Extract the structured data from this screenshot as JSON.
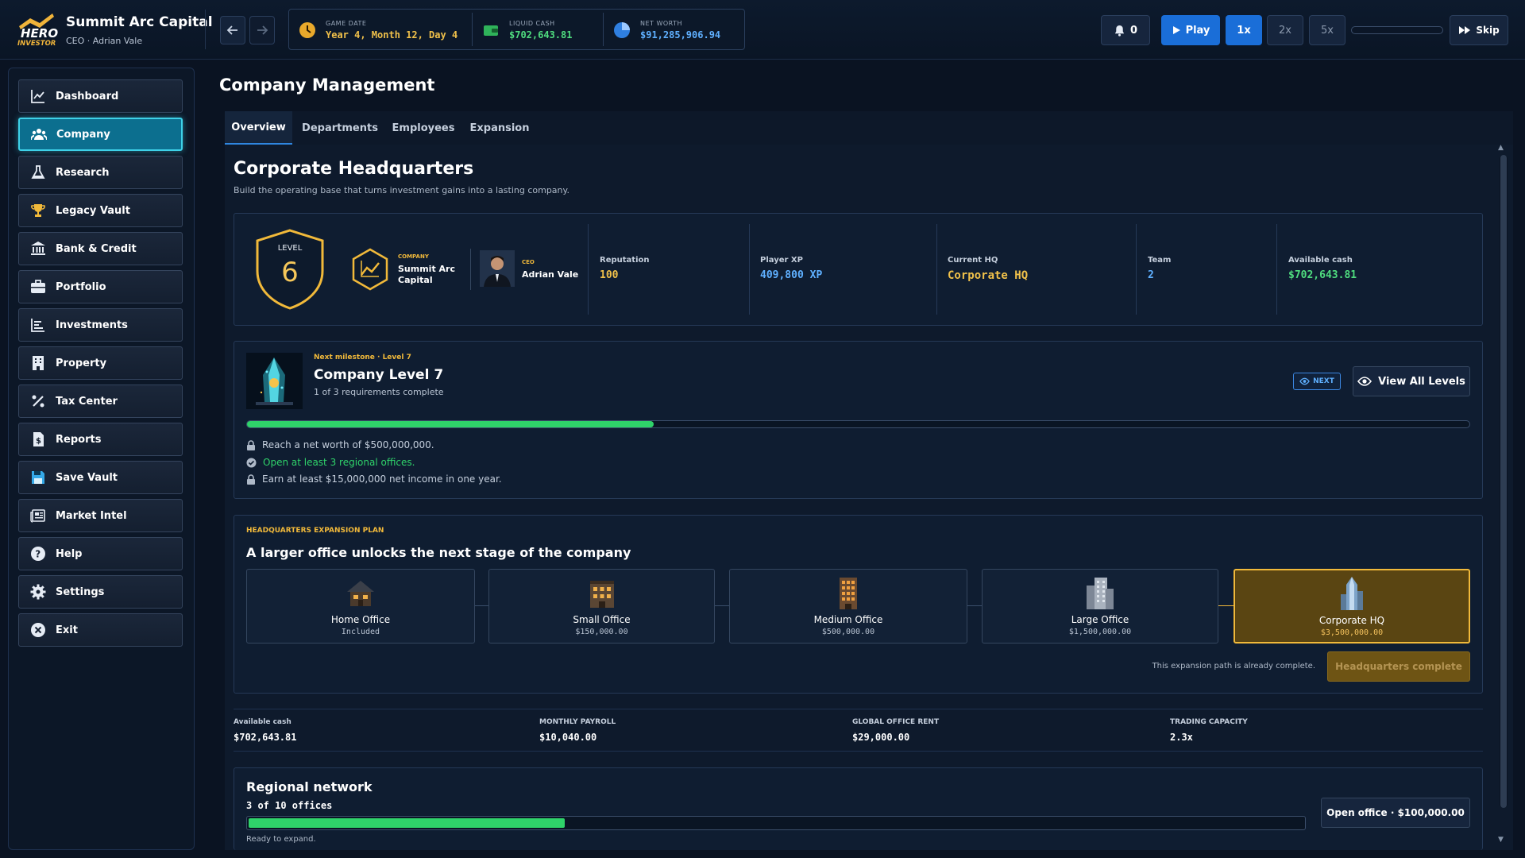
{
  "app": {
    "logo_top": "HERO",
    "logo_bottom": "INVESTOR",
    "company_name": "Summit Arc Capital",
    "subtitle": "CEO · Adrian Vale"
  },
  "topbar": {
    "game_date_label": "GAME DATE",
    "game_date_value": "Year 4, Month 12, Day 4",
    "liquid_cash_label": "LIQUID CASH",
    "liquid_cash_value": "$702,643.81",
    "net_worth_label": "NET WORTH",
    "net_worth_value": "$91,285,906.94",
    "notifications": "0",
    "play_label": "Play",
    "speed_1": "1x",
    "speed_2": "2x",
    "speed_5": "5x",
    "skip_label": "Skip"
  },
  "sidebar": {
    "items": [
      {
        "label": "Dashboard"
      },
      {
        "label": "Company"
      },
      {
        "label": "Research"
      },
      {
        "label": "Legacy Vault"
      },
      {
        "label": "Bank & Credit"
      },
      {
        "label": "Portfolio"
      },
      {
        "label": "Investments"
      },
      {
        "label": "Property"
      },
      {
        "label": "Tax Center"
      },
      {
        "label": "Reports"
      },
      {
        "label": "Save Vault"
      },
      {
        "label": "Market Intel"
      },
      {
        "label": "Help"
      },
      {
        "label": "Settings"
      },
      {
        "label": "Exit"
      }
    ]
  },
  "page": {
    "title": "Company Management",
    "tabs": [
      "Overview",
      "Departments",
      "Employees",
      "Expansion"
    ],
    "section_title": "Corporate Headquarters",
    "section_sub": "Build the operating base that turns investment gains into a lasting company."
  },
  "hq": {
    "level_label": "LEVEL",
    "level_value": "6",
    "company_label": "COMPANY",
    "company_line1": "Summit Arc",
    "company_line2": "Capital",
    "ceo_label": "CEO",
    "ceo_name": "Adrian Vale",
    "reputation_label": "Reputation",
    "reputation_value": "100",
    "xp_label": "Player XP",
    "xp_value": "409,800 XP",
    "current_hq_label": "Current HQ",
    "current_hq_value": "Corporate HQ",
    "team_label": "Team",
    "team_value": "2",
    "cash_label": "Available cash",
    "cash_value": "$702,643.81"
  },
  "milestone": {
    "eyebrow": "Next milestone · Level 7",
    "title": "Company Level 7",
    "sub": "1 of 3 requirements complete",
    "next_badge": "NEXT",
    "view_all_label": "View All Levels",
    "progress_fraction": 0.333,
    "requirements": [
      {
        "text": "Reach a net worth of $500,000,000.",
        "done": false
      },
      {
        "text": "Open at least 3 regional offices.",
        "done": true
      },
      {
        "text": "Earn at least $15,000,000 net income in one year.",
        "done": false
      }
    ]
  },
  "expansion": {
    "eyebrow": "HEADQUARTERS EXPANSION PLAN",
    "title": "A larger office unlocks the next stage of the company",
    "offices": [
      {
        "name": "Home Office",
        "price": "Included"
      },
      {
        "name": "Small Office",
        "price": "$150,000.00"
      },
      {
        "name": "Medium Office",
        "price": "$500,000.00"
      },
      {
        "name": "Large Office",
        "price": "$1,500,000.00"
      },
      {
        "name": "Corporate HQ",
        "price": "$3,500,000.00"
      }
    ],
    "note": "This expansion path is already complete.",
    "complete_label": "Headquarters complete"
  },
  "metrics": {
    "available_cash_label": "Available cash",
    "available_cash_value": "$702,643.81",
    "payroll_label": "MONTHLY PAYROLL",
    "payroll_value": "$10,040.00",
    "rent_label": "GLOBAL OFFICE RENT",
    "rent_value": "$29,000.00",
    "capacity_label": "TRADING CAPACITY",
    "capacity_value": "2.3x"
  },
  "regional": {
    "title": "Regional network",
    "count": "3 of 10 offices",
    "progress_fraction": 0.3,
    "status": "Ready to expand.",
    "open_label": "Open office · $100,000.00"
  },
  "colors": {
    "accent_blue": "#1a6ed8",
    "accent_cyan": "#3ed1e8",
    "gold": "#f1b93a",
    "green": "#2fd36a",
    "value_blue": "#5fb0ff"
  }
}
